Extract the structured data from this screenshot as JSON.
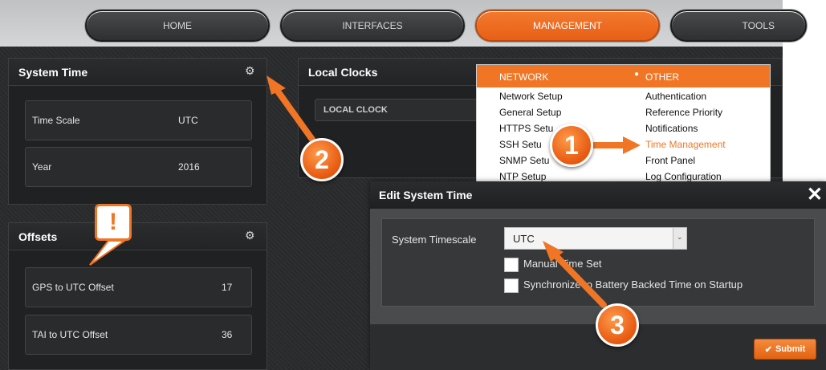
{
  "nav": {
    "items": [
      {
        "label": "HOME"
      },
      {
        "label": "INTERFACES"
      },
      {
        "label": "MANAGEMENT"
      },
      {
        "label": "TOOLS"
      }
    ],
    "active": "MANAGEMENT"
  },
  "system_time": {
    "title": "System Time",
    "rows": [
      {
        "label": "Time Scale",
        "value": "UTC"
      },
      {
        "label": "Year",
        "value": "2016"
      }
    ]
  },
  "offsets": {
    "title": "Offsets",
    "rows": [
      {
        "label": "GPS to UTC Offset",
        "value": "17"
      },
      {
        "label": "TAI to UTC Offset",
        "value": "36"
      }
    ]
  },
  "local_clocks": {
    "title": "Local Clocks",
    "column": "LOCAL CLOCK"
  },
  "management_menu": {
    "network_header": "NETWORK",
    "other_header": "OTHER",
    "network_items": [
      "Network Setup",
      "General Setup",
      "HTTPS Setu",
      "SSH Setu",
      "SNMP Setu",
      "NTP Setup"
    ],
    "other_items": [
      "Authentication",
      "Reference Priority",
      "Notifications",
      "Time Management",
      "Front Panel",
      "Log Configuration"
    ],
    "highlight_color": "#f07525"
  },
  "modal": {
    "title": "Edit System Time",
    "field_label": "System Timescale",
    "select_value": "UTC",
    "checkbox1": "Manual Time Set",
    "checkbox2": "Synchronize to Battery Backed Time on Startup",
    "submit_label": "Submit"
  },
  "callouts": {
    "one": "1",
    "two": "2",
    "three": "3",
    "alert": "!"
  },
  "colors": {
    "accent": "#f07525",
    "panel_bg": "#202123",
    "callout": "#e6580f"
  }
}
